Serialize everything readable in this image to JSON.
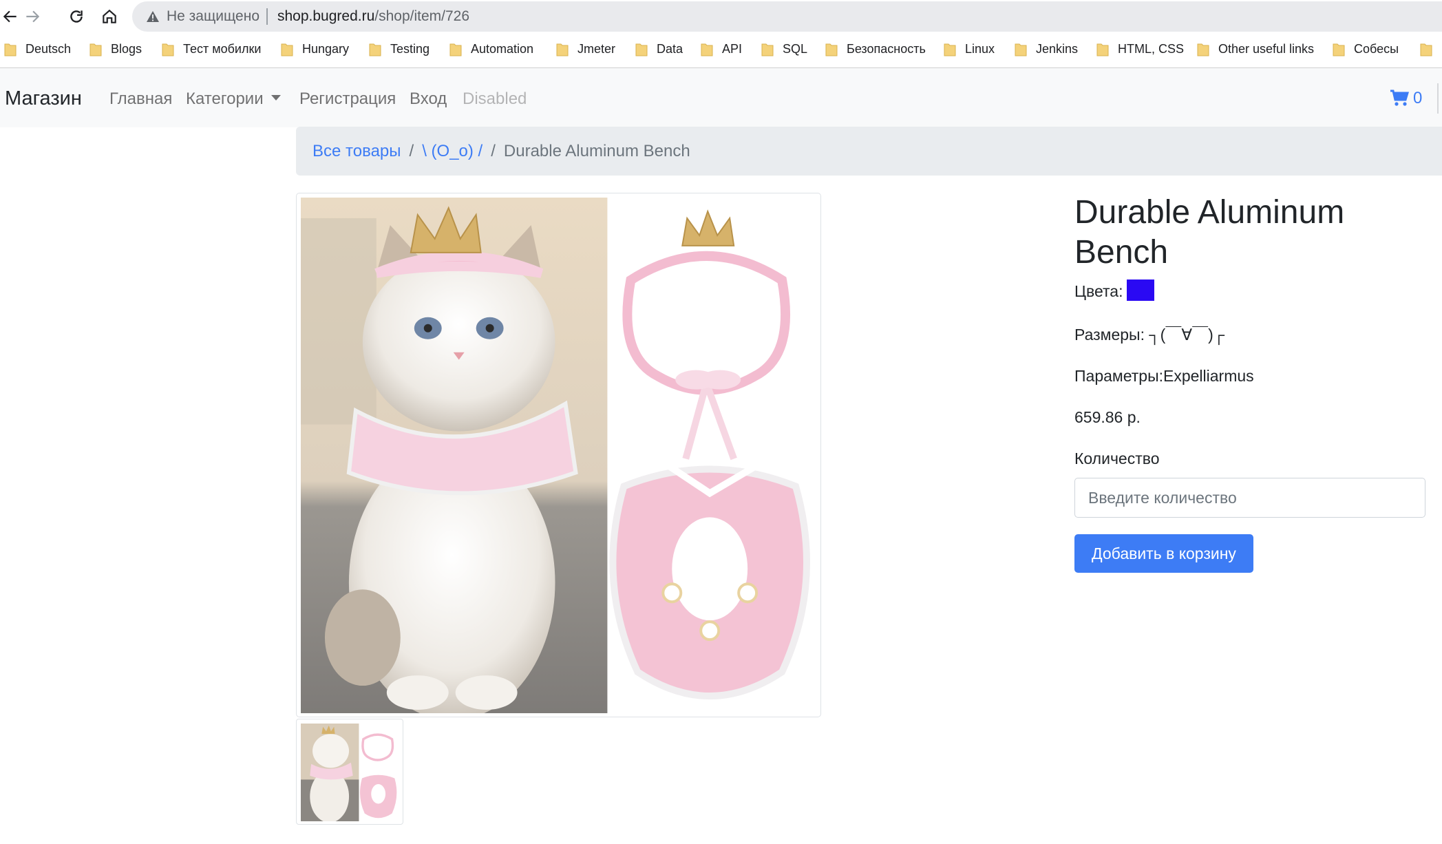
{
  "browser": {
    "security_label": "Не защищено",
    "url_host": "shop.bugred.ru",
    "url_path": "/shop/item/726",
    "bookmarks": [
      "Deutsch",
      "Blogs",
      "Тест мобилки",
      "Hungary",
      "Testing",
      "Automation",
      "Jmeter",
      "Data",
      "API",
      "SQL",
      "Безопасность",
      "Linux",
      "Jenkins",
      "HTML, CSS",
      "Other useful links",
      "Собесы"
    ]
  },
  "navbar": {
    "brand": "Магазин",
    "links": [
      "Главная",
      "Категории",
      "Регистрация",
      "Вход",
      "Disabled"
    ],
    "cart_count": "0"
  },
  "breadcrumb": {
    "all_items": "Все товары",
    "category": "\\ (O_o) /",
    "current": "Durable Aluminum Bench"
  },
  "product": {
    "title": "Durable Aluminum Bench",
    "colors_label": "Цвета:",
    "color_swatch": "#2a09f3",
    "sizes_label": "Размеры:",
    "sizes_value": "┐(￣∀￣)┌",
    "params_label": "Параметры:",
    "params_value": "Expelliarmus",
    "price": "659.86 р.",
    "quantity_label": "Количество",
    "quantity_placeholder": "Введите количество",
    "add_to_cart": "Добавить в корзину"
  },
  "colors": {
    "link": "#3d7cf5",
    "button": "#3d7cf5"
  }
}
